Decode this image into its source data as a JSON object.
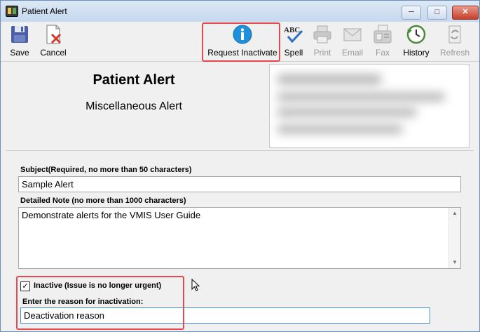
{
  "window": {
    "title": "Patient Alert"
  },
  "toolbar": {
    "save": "Save",
    "cancel": "Cancel",
    "request_inactivate": "Request Inactivate",
    "spell": "Spell",
    "print": "Print",
    "email": "Email",
    "fax": "Fax",
    "history": "History",
    "refresh": "Refresh"
  },
  "header": {
    "title": "Patient Alert",
    "subtitle": "Miscellaneous Alert"
  },
  "form": {
    "subject_label": "Subject(Required, no more than 50 characters)",
    "subject_value": "Sample Alert",
    "note_label": "Detailed Note (no more than 1000 characters)",
    "note_value": "Demonstrate alerts for the VMIS User Guide",
    "inactive_label": "Inactive (Issue is no longer urgent)",
    "inactive_checked": true,
    "reason_label": "Enter the reason for inactivation:",
    "reason_value": "Deactivation reason"
  },
  "colors": {
    "highlight": "#e8474f",
    "info_blue": "#1e8fd8"
  }
}
